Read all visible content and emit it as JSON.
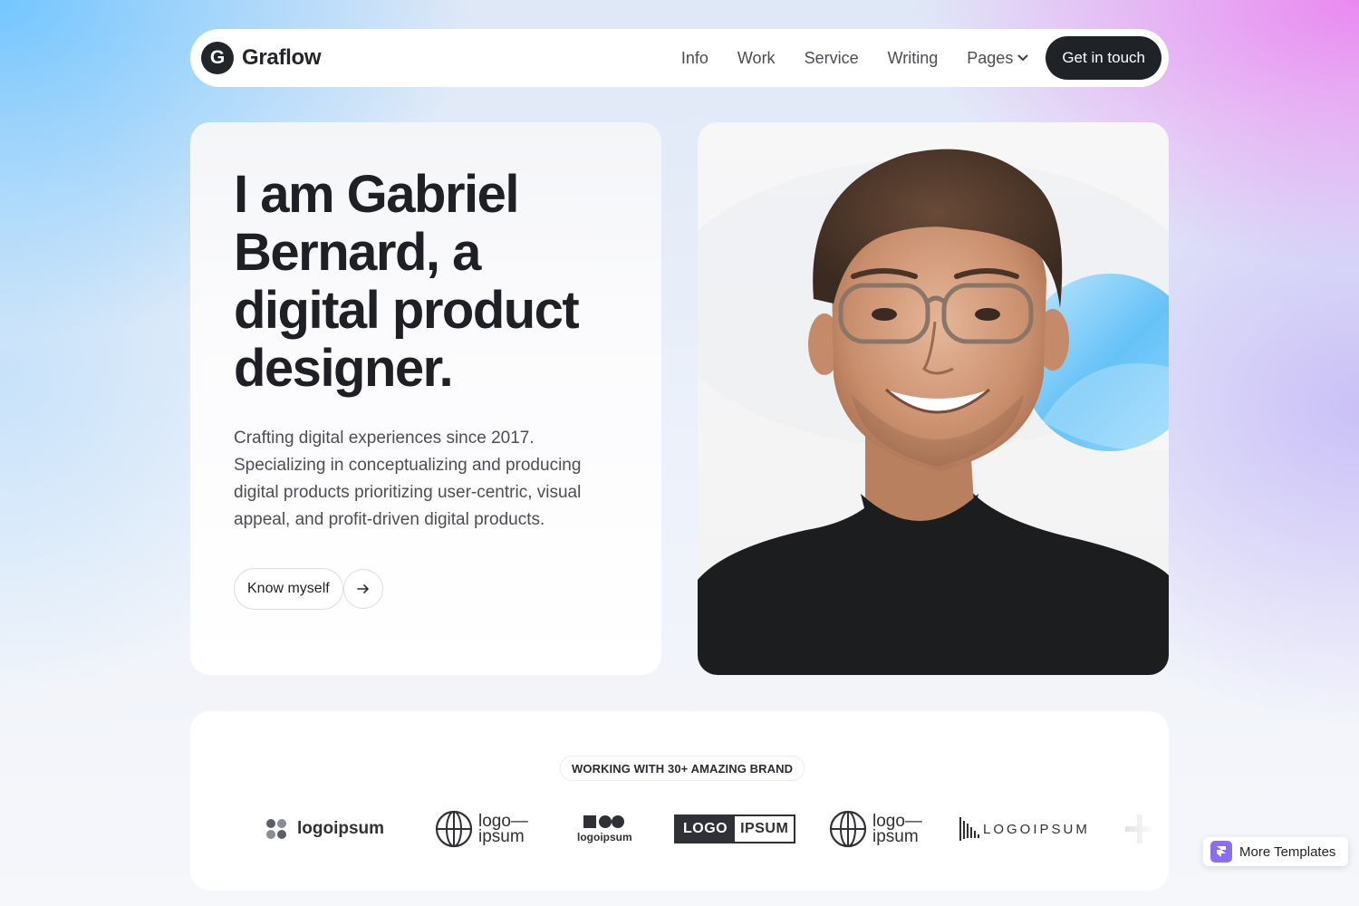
{
  "nav": {
    "brand_initial": "G",
    "brand_name": "Graflow",
    "items": [
      {
        "label": "Info"
      },
      {
        "label": "Work"
      },
      {
        "label": "Service"
      },
      {
        "label": "Writing"
      }
    ],
    "pages_label": "Pages",
    "cta_label": "Get in touch"
  },
  "hero": {
    "title": "I am Gabriel Bernard, a digital product designer.",
    "description": "Crafting digital experiences since 2017. Specializing in conceptualizing and producing digital products prioritizing user-centric, visual appeal, and profit-driven digital products.",
    "button_label": "Know myself",
    "arrow_icon": "arrow-right-icon"
  },
  "brands": {
    "heading": "WORKING WITH 30+ AMAZING BRAND",
    "logos": [
      {
        "text": "logoipsum"
      },
      {
        "text_top": "logo—",
        "text_bottom": "ipsum"
      },
      {
        "text": "logoipsum"
      },
      {
        "text_left": "LOGO",
        "text_right": "IPSUM"
      },
      {
        "text_top": "logo—",
        "text_bottom": "ipsum"
      },
      {
        "text": "LOGOIPSUM"
      }
    ]
  },
  "badge": {
    "label": "More Templates"
  },
  "colors": {
    "dark": "#1f2227",
    "accent_blue": "#6ec4ff",
    "accent_pink": "#ec78f0",
    "badge_purple": "#8b6cf2"
  }
}
